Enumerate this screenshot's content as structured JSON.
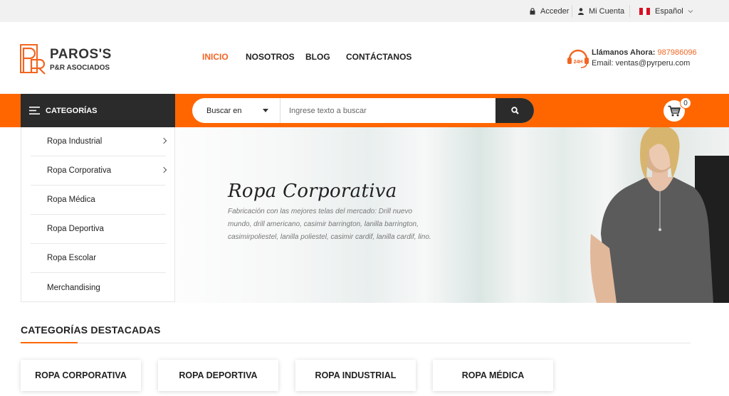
{
  "topbar": {
    "login_label": "Acceder",
    "account_label": "Mi Cuenta",
    "language_label": "Español"
  },
  "logo": {
    "title": "PAROS'S",
    "subtitle": "P&R ASOCIADOS"
  },
  "nav": {
    "items": [
      {
        "label": "INICIO",
        "active": true
      },
      {
        "label": "NOSOTROS",
        "active": false
      },
      {
        "label": "BLOG",
        "active": false
      },
      {
        "label": "CONTÁCTANOS",
        "active": false
      }
    ]
  },
  "contact": {
    "call_label": "Llámanos Ahora:",
    "phone": "987986096",
    "email": "Email: ventas@pyrperu.com"
  },
  "categories_header": "CATEGORÍAS",
  "search": {
    "select_label": "Buscar en",
    "placeholder": "Ingrese texto a buscar"
  },
  "cart": {
    "count": "0"
  },
  "sidebar": {
    "items": [
      {
        "label": "Ropa Industrial"
      },
      {
        "label": "Ropa Corporativa"
      },
      {
        "label": "Ropa Médica"
      },
      {
        "label": "Ropa Deportiva"
      },
      {
        "label": "Ropa Escolar"
      },
      {
        "label": "Merchandising"
      }
    ]
  },
  "hero": {
    "title": "Ropa Corporativa",
    "text": "Fabricación con las mejores telas del mercado: Drill nuevo mundo, drill americano, casimir barrington, lanilla barrington, casimirpoliestel, lanilla poliestel, casimir cardif, lanilla cardif, lino."
  },
  "featured": {
    "title": "CATEGORÍAS DESTACADAS",
    "cards": [
      {
        "label": "ROPA CORPORATIVA"
      },
      {
        "label": "ROPA DEPORTIVA"
      },
      {
        "label": "ROPA INDUSTRIAL"
      },
      {
        "label": "ROPA MÉDICA"
      }
    ]
  },
  "colors": {
    "accent": "#ff6600",
    "dark": "#2b2b2b"
  }
}
